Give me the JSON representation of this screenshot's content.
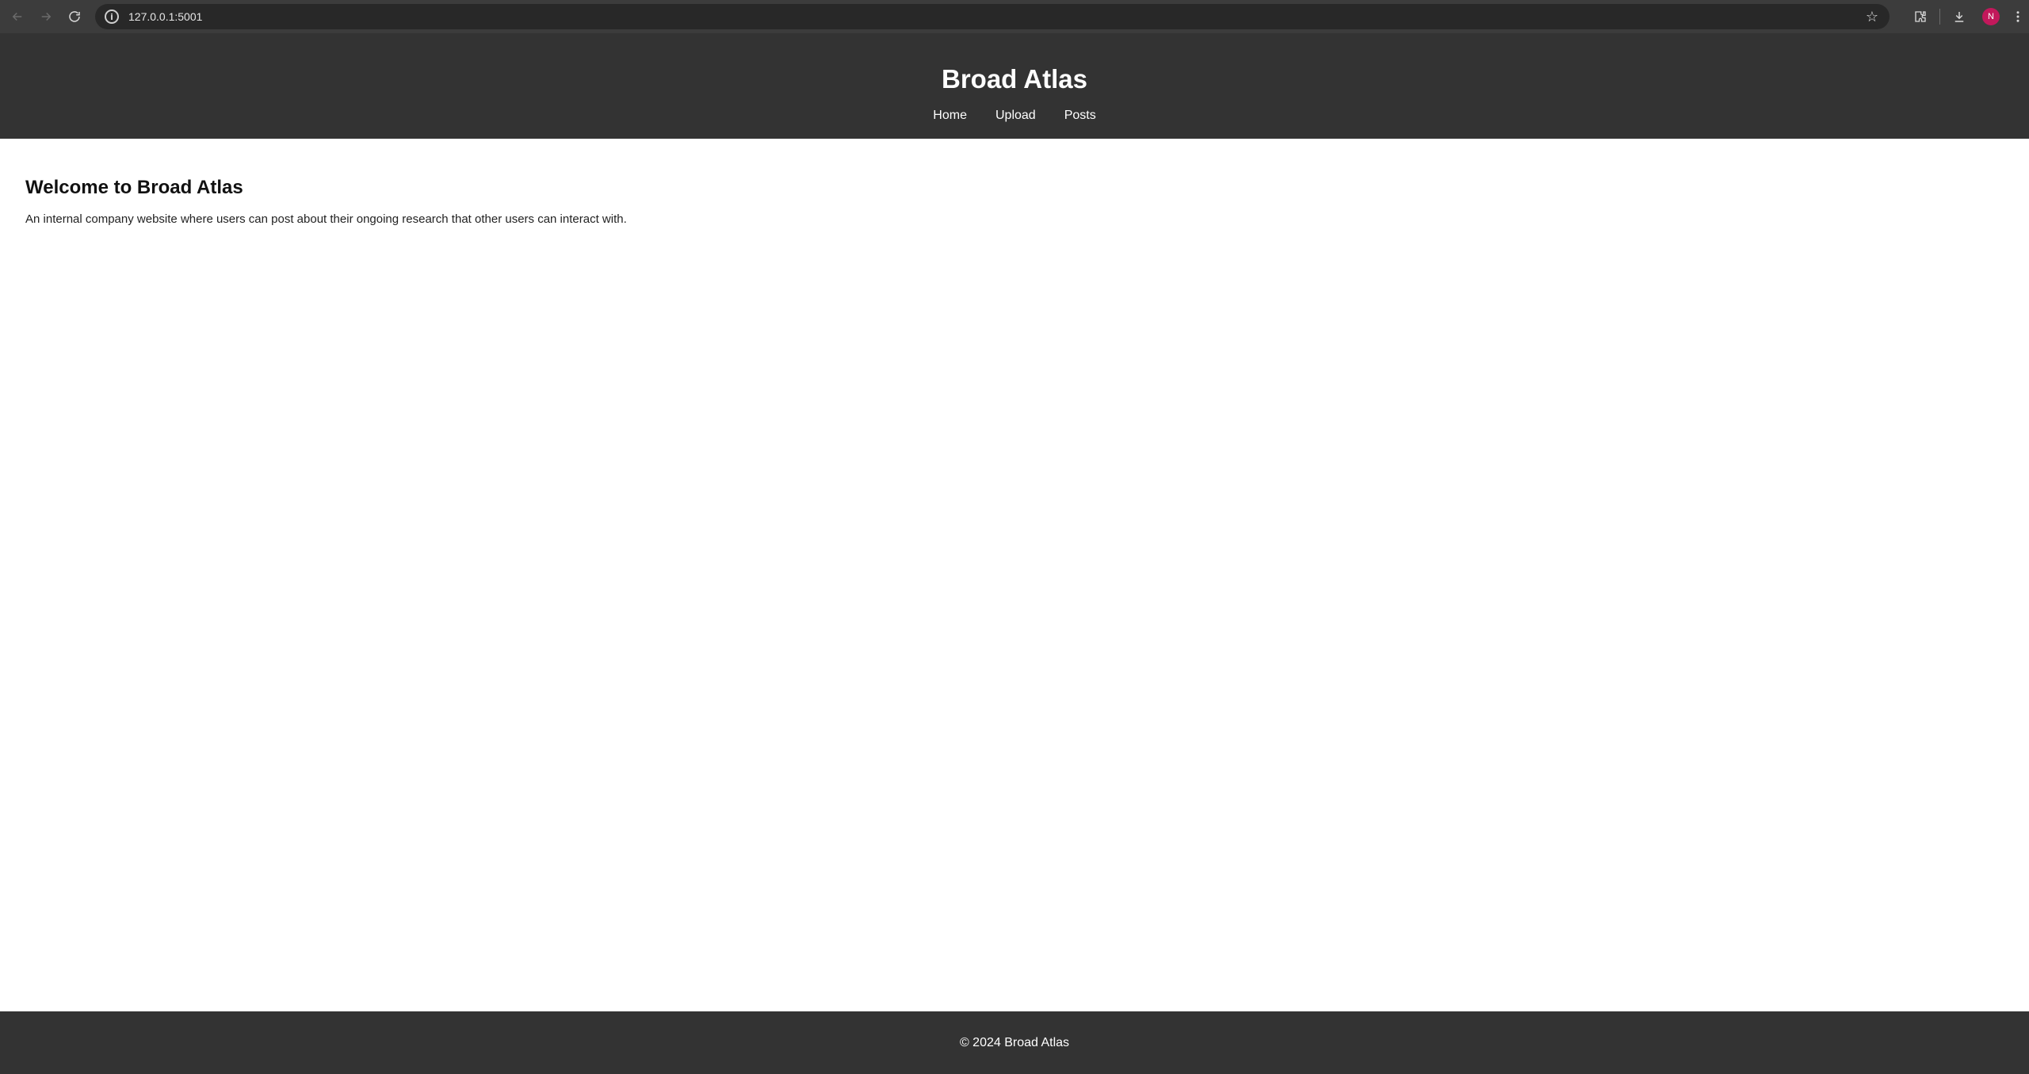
{
  "browser": {
    "url": "127.0.0.1:5001",
    "avatar_initial": "N"
  },
  "header": {
    "title": "Broad Atlas",
    "nav": {
      "home": "Home",
      "upload": "Upload",
      "posts": "Posts"
    }
  },
  "main": {
    "heading": "Welcome to Broad Atlas",
    "description": "An internal company website where users can post about their ongoing research that other users can interact with."
  },
  "footer": {
    "text": "© 2024 Broad Atlas"
  },
  "icons": {
    "back": "back-arrow-icon",
    "forward": "forward-arrow-icon",
    "reload": "reload-icon",
    "site_info": "info-icon",
    "bookmark": "star-icon",
    "extensions": "puzzle-icon",
    "downloads": "download-icon",
    "menu": "kebab-menu-icon"
  },
  "colors": {
    "header_bg": "#333333",
    "footer_bg": "#333333",
    "avatar_bg": "#c2185b"
  }
}
